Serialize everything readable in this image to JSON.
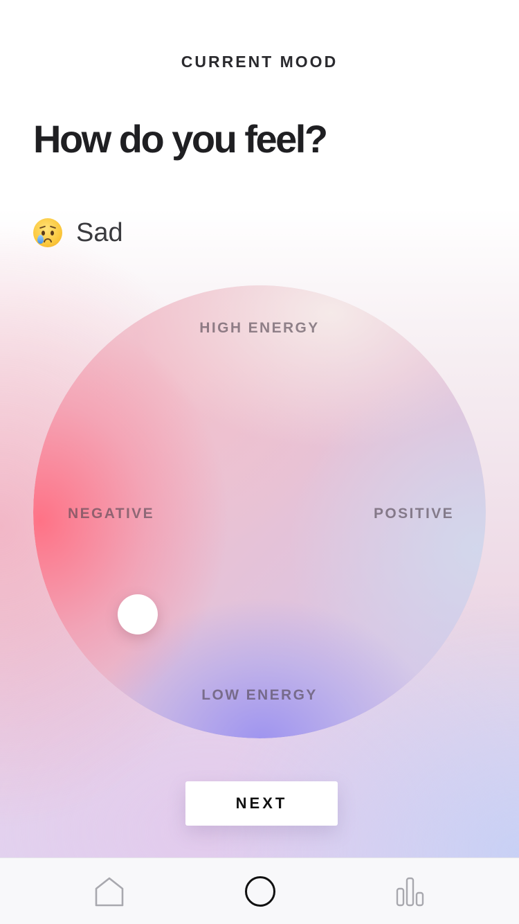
{
  "header": {
    "title": "CURRENT MOOD",
    "question": "How do you feel?"
  },
  "mood": {
    "emoji_icon": "crying-face-emoji",
    "label": "Sad"
  },
  "wheel": {
    "top_label": "HIGH ENERGY",
    "bottom_label": "LOW ENERGY",
    "left_label": "NEGATIVE",
    "right_label": "POSITIVE"
  },
  "actions": {
    "next_label": "NEXT"
  },
  "tab_bar": {
    "items": [
      {
        "icon": "home-icon",
        "active": false
      },
      {
        "icon": "circle-icon",
        "active": true
      },
      {
        "icon": "bar-chart-icon",
        "active": false
      }
    ]
  },
  "colors": {
    "negative_accent": "#ff6e82",
    "low_energy_accent": "#9b91f0",
    "positive_accent": "#d2d8ec",
    "icon_inactive": "#a8a8ae",
    "icon_active": "#111111"
  }
}
